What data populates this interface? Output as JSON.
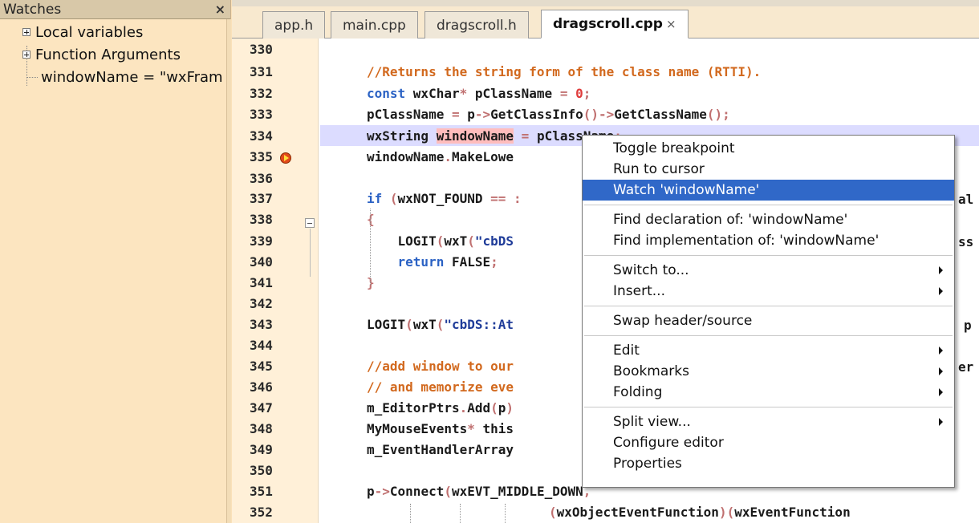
{
  "watches": {
    "title": "Watches",
    "close": "×",
    "items": [
      {
        "label": "Local variables"
      },
      {
        "label": "Function Arguments"
      },
      {
        "label": "windowName = \"wxFram"
      }
    ]
  },
  "tabs": [
    {
      "label": "app.h"
    },
    {
      "label": "main.cpp"
    },
    {
      "label": "dragscroll.h"
    },
    {
      "label": "dragscroll.cpp",
      "close": "×"
    }
  ],
  "line_numbers": [
    "330",
    "331",
    "332",
    "333",
    "334",
    "335",
    "336",
    "337",
    "338",
    "339",
    "340",
    "341",
    "342",
    "343",
    "344",
    "345",
    "346",
    "347",
    "348",
    "349",
    "350",
    "351",
    "352"
  ],
  "code_lines": [
    "",
    "//Returns the string form of the class name (RTTI).",
    "const wxChar* pClassName = 0;",
    "pClassName = p->GetClassInfo()->GetClassName();",
    "wxString windowName = pClassName;",
    "windowName.MakeLowe",
    "",
    "if (wxNOT_FOUND == ",
    "{",
    "LOGIT(wxT(\"cbDS",
    "return FALSE;",
    "}",
    "",
    "LOGIT(wxT(\"cbDS::At",
    "",
    "//add window to our",
    "// and memorize eve",
    "m_EditorPtrs.Add(p)",
    "MyMouseEvents* this",
    "m_EventHandlerArray",
    "",
    "p->Connect(wxEVT_MIDDLE_DOWN,",
    "(wxObjectEventFunction)(wxEventFunction"
  ],
  "code_right_fragments": {
    "line337": "al",
    "line339": "ss",
    "line343": "p",
    "line345": "er"
  },
  "context_menu": {
    "items": [
      {
        "label": "Toggle breakpoint"
      },
      {
        "label": "Run to cursor"
      },
      {
        "label": "Watch 'windowName'",
        "selected": true
      },
      {
        "label": "Find declaration of: 'windowName'"
      },
      {
        "label": "Find implementation of: 'windowName'"
      },
      {
        "label": "Switch to..."
      },
      {
        "label": "Insert..."
      },
      {
        "label": "Swap header/source"
      },
      {
        "label": "Edit"
      },
      {
        "label": "Bookmarks"
      },
      {
        "label": "Folding"
      },
      {
        "label": "Split view..."
      },
      {
        "label": "Configure editor"
      },
      {
        "label": "Properties"
      }
    ]
  },
  "colors": {
    "panel_bg": "#fce5c0",
    "gutter_bg": "#fff0d8",
    "line_highlight": "#dcdcff",
    "menu_selected": "#3068c8",
    "comment": "#d2691e",
    "keyword": "#2b62c4",
    "breakpoint": "#e24a1a"
  }
}
